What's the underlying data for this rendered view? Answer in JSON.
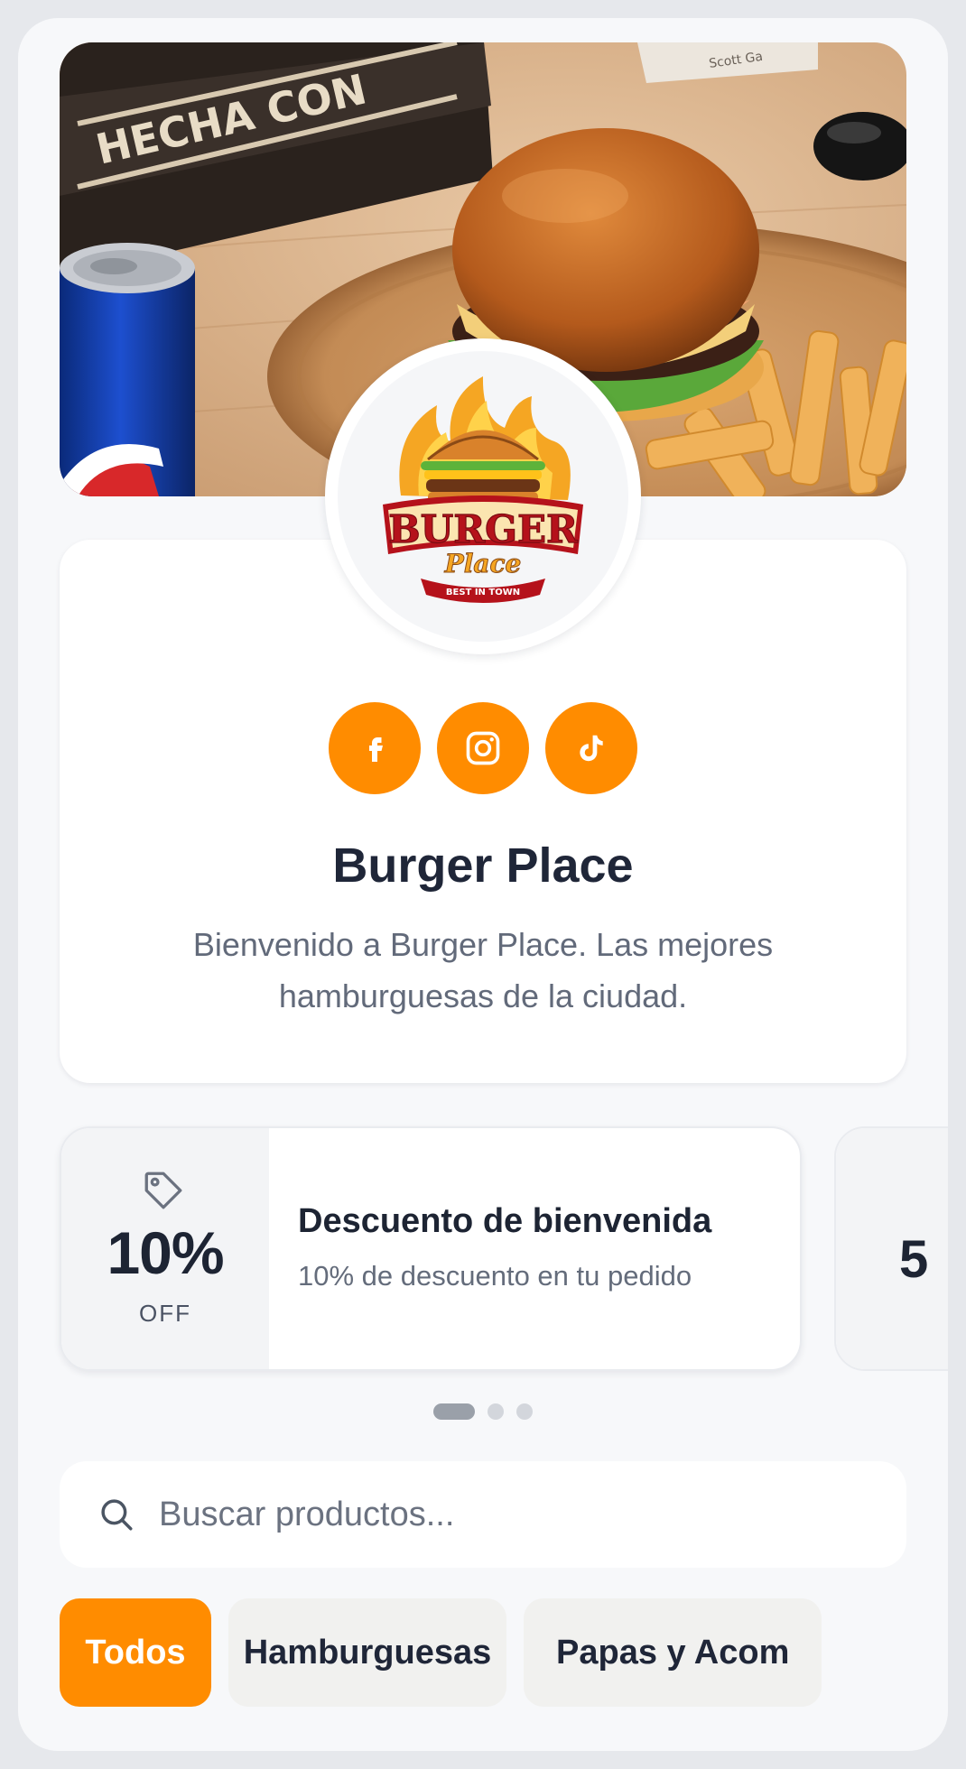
{
  "restaurant": {
    "name": "Burger Place",
    "description": "Bienvenido a Burger Place. Las mejores hamburguesas de la ciudad.",
    "hero_box_text": "HECHA CON",
    "hero_note_text": "Scott Ga",
    "logo": {
      "main": "BURGER",
      "script": "Place",
      "ribbon": "BEST IN TOWN"
    }
  },
  "socials": [
    {
      "name": "facebook",
      "icon": "facebook-icon"
    },
    {
      "name": "instagram",
      "icon": "instagram-icon"
    },
    {
      "name": "tiktok",
      "icon": "tiktok-icon"
    }
  ],
  "promos": [
    {
      "percent": "10%",
      "off_label": "OFF",
      "title": "Descuento de bienvenida",
      "subtitle": "10% de descuento en tu pedido",
      "icon": "tag-icon"
    },
    {
      "percent_peek": "5"
    }
  ],
  "carousel": {
    "count": 3,
    "active_index": 0
  },
  "search": {
    "placeholder": "Buscar productos...",
    "value": ""
  },
  "categories": [
    {
      "label": "Todos",
      "active": true
    },
    {
      "label": "Hamburguesas",
      "active": false
    },
    {
      "label": "Papas y Acom",
      "active": false
    }
  ],
  "colors": {
    "accent": "#ff8c00",
    "text_dark": "#1d2433",
    "text_muted": "#646c7b",
    "background": "#f7f8fa"
  }
}
